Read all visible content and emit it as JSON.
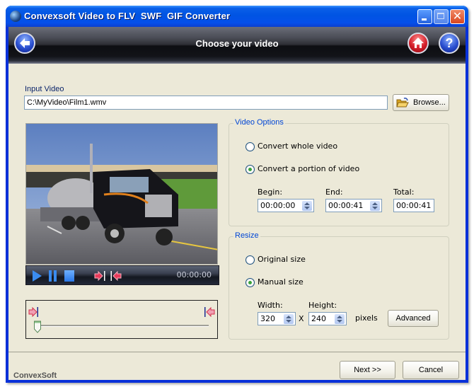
{
  "window": {
    "title": "Convexsoft Video to FLV  SWF  GIF Converter",
    "controls": {
      "minimize": "minimize",
      "maximize": "maximize",
      "close": "✕"
    }
  },
  "header": {
    "title": "Choose your video",
    "back_icon": "back-arrow-icon",
    "home_icon": "home-icon",
    "help_icon": "help-icon"
  },
  "input": {
    "label": "Input Video",
    "value": "C:\\MyVideo\\Film1.wmv",
    "browse_label": "Browse..."
  },
  "player": {
    "time": "00:00:00",
    "controls": [
      "play-icon",
      "pause-icon",
      "stop-icon",
      "mark-in-icon",
      "mark-out-icon"
    ],
    "position_fraction": 0.0
  },
  "video_options": {
    "title": "Video Options",
    "options": [
      {
        "label": "Convert whole video",
        "checked": false
      },
      {
        "label": "Convert a portion of video",
        "checked": true
      }
    ],
    "begin_label": "Begin:",
    "begin_value": "00:00:00",
    "end_label": "End:",
    "end_value": "00:00:41",
    "total_label": "Total:",
    "total_value": "00:00:41"
  },
  "resize": {
    "title": "Resize",
    "options": [
      {
        "label": "Original size",
        "checked": false
      },
      {
        "label": "Manual size",
        "checked": true
      }
    ],
    "width_label": "Width:",
    "width_value": "320",
    "x_label": "X",
    "height_label": "Height:",
    "height_value": "240",
    "unit_label": "pixels",
    "advanced_label": "Advanced"
  },
  "footer": {
    "brand": "ConvexSoft",
    "next_label": "Next >>",
    "cancel_label": "Cancel"
  },
  "colors": {
    "title_bar": "#0054e3",
    "client_bg": "#ece9d8",
    "group_title": "#0046d5",
    "label_blue": "#0a246a"
  }
}
